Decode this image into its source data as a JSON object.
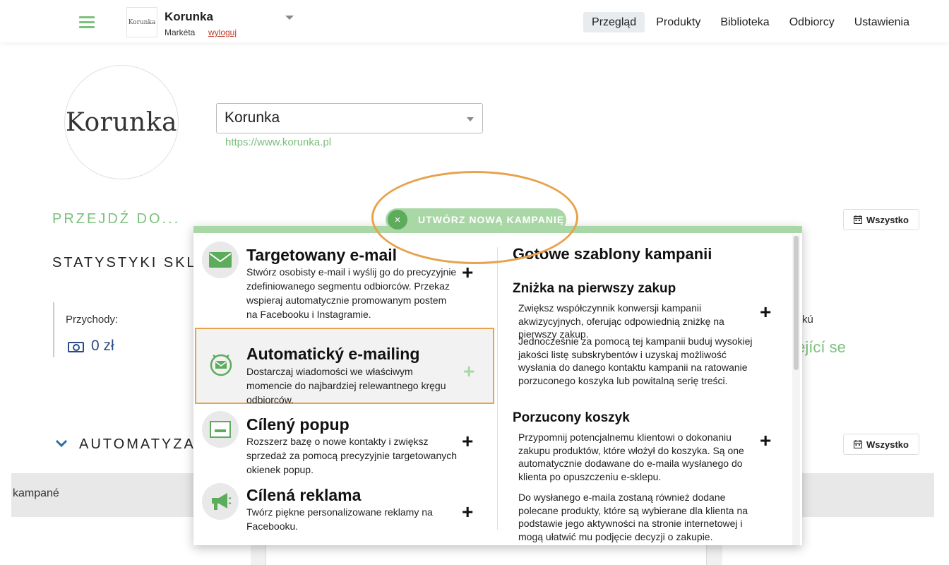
{
  "header": {
    "shop_logo_text": "Korunka",
    "shop_name": "Korunka",
    "user_name": "Markéta",
    "logout_label": "wyloguj",
    "nav": [
      {
        "label": "Przegląd",
        "active": true
      },
      {
        "label": "Produkty",
        "active": false
      },
      {
        "label": "Biblioteka",
        "active": false
      },
      {
        "label": "Odbiorcy",
        "active": false
      },
      {
        "label": "Ustawienia",
        "active": false
      }
    ]
  },
  "profile": {
    "logo_text": "Korunka",
    "shop_select_value": "Korunka",
    "shop_url": "https://www.korunka.pl"
  },
  "sections": {
    "goto_label": "PRZEJDŹ DO...",
    "stats_label": "STATYSTYKI SKLEPU",
    "automation_label": "AUTOMATYZACJ",
    "filter_label": "Wszystko"
  },
  "stats": {
    "revenue_label": "Przychody:",
    "revenue_value": "0 zł",
    "partial_right_label": "kú",
    "partial_right_value": "tející se"
  },
  "table": {
    "band_label": "kampané"
  },
  "create_campaign": {
    "button_label": "UTWÓRZ NOWĄ KAMPANIĘ",
    "close_symbol": "×",
    "options": [
      {
        "title": "Targetowany e-mail",
        "description": "Stwórz osobisty e-mail i wyślij go do precyzyjnie zdefiniowanego segmentu odbiorców. Przekaz wspieraj automatycznie promowanym postem na Facebooku i Instagramie.",
        "icon": "envelope-icon"
      },
      {
        "title": "Automatický e-mailing",
        "description": "Dostarczaj wiadomości we właściwym momencie do najbardziej relewantnego kręgu odbiorców.",
        "icon": "clock-envelope-icon"
      },
      {
        "title": "Cílený popup",
        "description": "Rozszerz bazę o nowe kontakty i zwiększ sprzedaż za pomocą precyzyjnie targetowanych okienek popup.",
        "icon": "popup-window-icon"
      },
      {
        "title": "Cílená reklama",
        "description": "Twórz piękne personalizowane reklamy na Facebooku.",
        "icon": "megaphone-icon"
      }
    ],
    "plus_symbol": "+",
    "templates_title": "Gotowe szablony kampanii",
    "templates": [
      {
        "title": "Zniżka na pierwszy zakup",
        "p1": "Zwiększ współczynnik konwersji kampanii akwizycyjnych, oferując odpowiednią zniżkę na pierwszy zakup.",
        "p2": "Jednocześnie za pomocą tej kampanii buduj wysokiej jakości listę subskrybentów i uzyskaj możliwość wysłania do danego kontaktu kampanii na ratowanie porzuconego koszyka lub powitalną serię treści."
      },
      {
        "title": "Porzucony koszyk",
        "p1": "Przypomnij potencjalnemu klientowi o dokonaniu zakupu produktów, które włożył do koszyka. Są one automatycznie dodawane do e-maila wysłanego do klienta po opuszczeniu e-sklepu.",
        "p2": "Do wysłanego e-maila zostaną również dodane polecane produkty, które są wybierane dla klienta na podstawie jego aktywności na stronie internetowej i mogą ułatwić mu podjęcie decyzji o zakupie."
      }
    ]
  },
  "colors": {
    "accent_green": "#7cc07e",
    "highlight_orange": "#e8a24b",
    "logout_red": "#c0392b",
    "value_blue": "#2b4a8a"
  }
}
